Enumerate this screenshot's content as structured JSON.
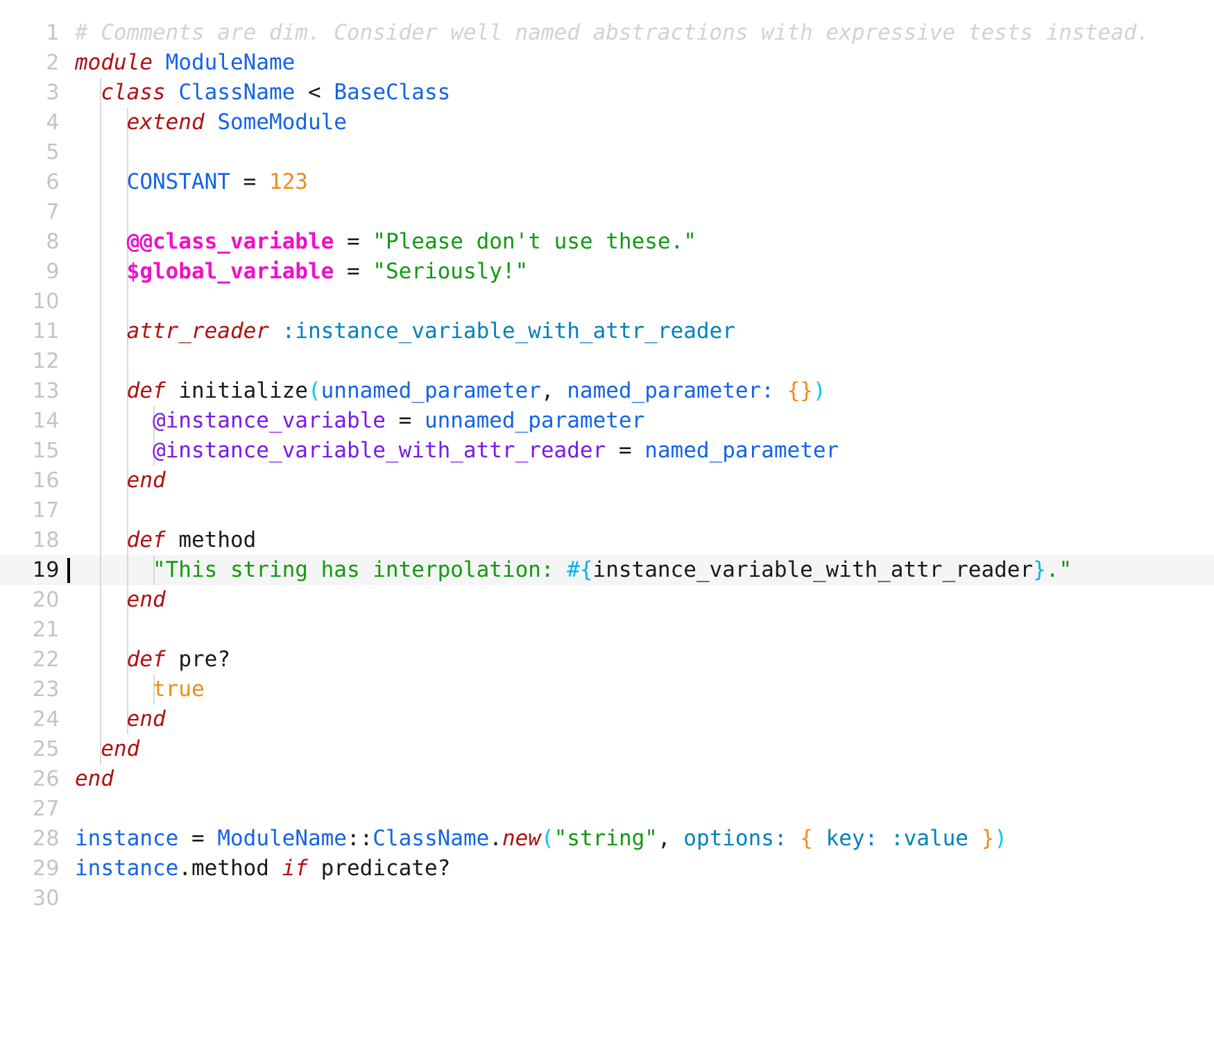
{
  "editor": {
    "language": "ruby",
    "active_line": 19,
    "total_lines": 30,
    "theme": {
      "background": "#ffffff",
      "active_line_background": "#f5f5f5",
      "gutter_text": "#c3c3c3",
      "gutter_active_text": "#1a1a1a",
      "cursor": "#000000",
      "indent_guide": "#d9d9d9",
      "comment": "#d2d2d2",
      "keyword": "#b01010",
      "constant": "#1464e6",
      "identifier": "#1464e6",
      "plain": "#1a1a1a",
      "number": "#f28c18",
      "boolean": "#f28c18",
      "string": "#119911",
      "class_variable": "#f010c8",
      "global_variable": "#f010c8",
      "instance_variable": "#7a1ae6",
      "symbol": "#0081bd",
      "bracket_level_1": "#00c8e6",
      "bracket_level_2": "#f28c18",
      "interpolation": "#00b4e6"
    }
  },
  "lines": [
    {
      "number": "1",
      "indent": 0,
      "guides": 0,
      "tokens": [
        {
          "c": "t-comment",
          "t": "# Comments are dim. Consider well named abstractions with expressive tests instead."
        }
      ]
    },
    {
      "number": "2",
      "indent": 0,
      "guides": 0,
      "tokens": [
        {
          "c": "t-kw",
          "t": "module"
        },
        {
          "c": "t-plain",
          "t": " "
        },
        {
          "c": "t-const",
          "t": "ModuleName"
        }
      ]
    },
    {
      "number": "3",
      "indent": 1,
      "guides": 1,
      "tokens": [
        {
          "c": "t-plain",
          "t": "  "
        },
        {
          "c": "t-kw",
          "t": "class"
        },
        {
          "c": "t-plain",
          "t": " "
        },
        {
          "c": "t-const",
          "t": "ClassName"
        },
        {
          "c": "t-plain",
          "t": " "
        },
        {
          "c": "t-op",
          "t": "<"
        },
        {
          "c": "t-plain",
          "t": " "
        },
        {
          "c": "t-const",
          "t": "BaseClass"
        }
      ]
    },
    {
      "number": "4",
      "indent": 2,
      "guides": 2,
      "tokens": [
        {
          "c": "t-plain",
          "t": "    "
        },
        {
          "c": "t-kw",
          "t": "extend"
        },
        {
          "c": "t-plain",
          "t": " "
        },
        {
          "c": "t-const",
          "t": "SomeModule"
        }
      ]
    },
    {
      "number": "5",
      "indent": 0,
      "guides": 2,
      "tokens": []
    },
    {
      "number": "6",
      "indent": 2,
      "guides": 2,
      "tokens": [
        {
          "c": "t-plain",
          "t": "    "
        },
        {
          "c": "t-const",
          "t": "CONSTANT"
        },
        {
          "c": "t-plain",
          "t": " "
        },
        {
          "c": "t-op",
          "t": "="
        },
        {
          "c": "t-plain",
          "t": " "
        },
        {
          "c": "t-num",
          "t": "123"
        }
      ]
    },
    {
      "number": "7",
      "indent": 0,
      "guides": 2,
      "tokens": []
    },
    {
      "number": "8",
      "indent": 2,
      "guides": 2,
      "tokens": [
        {
          "c": "t-plain",
          "t": "    "
        },
        {
          "c": "t-cvar",
          "t": "@@class_variable"
        },
        {
          "c": "t-plain",
          "t": " "
        },
        {
          "c": "t-op",
          "t": "="
        },
        {
          "c": "t-plain",
          "t": " "
        },
        {
          "c": "t-str",
          "t": "\"Please don't use these.\""
        }
      ]
    },
    {
      "number": "9",
      "indent": 2,
      "guides": 2,
      "tokens": [
        {
          "c": "t-plain",
          "t": "    "
        },
        {
          "c": "t-gvar",
          "t": "$global_variable"
        },
        {
          "c": "t-plain",
          "t": " "
        },
        {
          "c": "t-op",
          "t": "="
        },
        {
          "c": "t-plain",
          "t": " "
        },
        {
          "c": "t-str",
          "t": "\"Seriously!\""
        }
      ]
    },
    {
      "number": "10",
      "indent": 0,
      "guides": 2,
      "tokens": []
    },
    {
      "number": "11",
      "indent": 2,
      "guides": 2,
      "tokens": [
        {
          "c": "t-plain",
          "t": "    "
        },
        {
          "c": "t-kw",
          "t": "attr_reader"
        },
        {
          "c": "t-plain",
          "t": " "
        },
        {
          "c": "t-sym",
          "t": ":instance_variable_with_attr_reader"
        }
      ]
    },
    {
      "number": "12",
      "indent": 0,
      "guides": 2,
      "tokens": []
    },
    {
      "number": "13",
      "indent": 2,
      "guides": 2,
      "tokens": [
        {
          "c": "t-plain",
          "t": "    "
        },
        {
          "c": "t-kw",
          "t": "def"
        },
        {
          "c": "t-plain",
          "t": " "
        },
        {
          "c": "t-plain",
          "t": "initialize"
        },
        {
          "c": "t-br1",
          "t": "("
        },
        {
          "c": "t-ident",
          "t": "unnamed_parameter"
        },
        {
          "c": "t-op",
          "t": ","
        },
        {
          "c": "t-plain",
          "t": " "
        },
        {
          "c": "t-ident",
          "t": "named_parameter:"
        },
        {
          "c": "t-plain",
          "t": " "
        },
        {
          "c": "t-br2",
          "t": "{}"
        },
        {
          "c": "t-br1",
          "t": ")"
        }
      ]
    },
    {
      "number": "14",
      "indent": 3,
      "guides": 3,
      "tokens": [
        {
          "c": "t-plain",
          "t": "      "
        },
        {
          "c": "t-ivar",
          "t": "@instance_variable"
        },
        {
          "c": "t-plain",
          "t": " "
        },
        {
          "c": "t-op",
          "t": "="
        },
        {
          "c": "t-plain",
          "t": " "
        },
        {
          "c": "t-ident",
          "t": "unnamed_parameter"
        }
      ]
    },
    {
      "number": "15",
      "indent": 3,
      "guides": 3,
      "tokens": [
        {
          "c": "t-plain",
          "t": "      "
        },
        {
          "c": "t-ivar",
          "t": "@instance_variable_with_attr_reader"
        },
        {
          "c": "t-plain",
          "t": " "
        },
        {
          "c": "t-op",
          "t": "="
        },
        {
          "c": "t-plain",
          "t": " "
        },
        {
          "c": "t-ident",
          "t": "named_parameter"
        }
      ]
    },
    {
      "number": "16",
      "indent": 2,
      "guides": 2,
      "tokens": [
        {
          "c": "t-plain",
          "t": "    "
        },
        {
          "c": "t-kw",
          "t": "end"
        }
      ]
    },
    {
      "number": "17",
      "indent": 0,
      "guides": 2,
      "tokens": []
    },
    {
      "number": "18",
      "indent": 2,
      "guides": 2,
      "tokens": [
        {
          "c": "t-plain",
          "t": "    "
        },
        {
          "c": "t-kw",
          "t": "def"
        },
        {
          "c": "t-plain",
          "t": " "
        },
        {
          "c": "t-plain",
          "t": "method"
        }
      ]
    },
    {
      "number": "19",
      "indent": 3,
      "guides": 3,
      "active": true,
      "tokens": [
        {
          "c": "t-plain",
          "t": "      "
        },
        {
          "c": "t-str",
          "t": "\"This string has interpolation: "
        },
        {
          "c": "t-interp",
          "t": "#{"
        },
        {
          "c": "t-plain",
          "t": "instance_variable_with_attr_reader"
        },
        {
          "c": "t-interp",
          "t": "}"
        },
        {
          "c": "t-str",
          "t": ".\""
        }
      ]
    },
    {
      "number": "20",
      "indent": 2,
      "guides": 2,
      "tokens": [
        {
          "c": "t-plain",
          "t": "    "
        },
        {
          "c": "t-kw",
          "t": "end"
        }
      ]
    },
    {
      "number": "21",
      "indent": 0,
      "guides": 2,
      "tokens": []
    },
    {
      "number": "22",
      "indent": 2,
      "guides": 2,
      "tokens": [
        {
          "c": "t-plain",
          "t": "    "
        },
        {
          "c": "t-kw",
          "t": "def"
        },
        {
          "c": "t-plain",
          "t": " "
        },
        {
          "c": "t-plain",
          "t": "pre?"
        }
      ]
    },
    {
      "number": "23",
      "indent": 3,
      "guides": 3,
      "tokens": [
        {
          "c": "t-plain",
          "t": "      "
        },
        {
          "c": "t-bool",
          "t": "true"
        }
      ]
    },
    {
      "number": "24",
      "indent": 2,
      "guides": 2,
      "tokens": [
        {
          "c": "t-plain",
          "t": "    "
        },
        {
          "c": "t-kw",
          "t": "end"
        }
      ]
    },
    {
      "number": "25",
      "indent": 1,
      "guides": 1,
      "tokens": [
        {
          "c": "t-plain",
          "t": "  "
        },
        {
          "c": "t-kw",
          "t": "end"
        }
      ]
    },
    {
      "number": "26",
      "indent": 0,
      "guides": 0,
      "tokens": [
        {
          "c": "t-kw",
          "t": "end"
        }
      ]
    },
    {
      "number": "27",
      "indent": 0,
      "guides": 0,
      "tokens": []
    },
    {
      "number": "28",
      "indent": 0,
      "guides": 0,
      "tokens": [
        {
          "c": "t-ident",
          "t": "instance"
        },
        {
          "c": "t-plain",
          "t": " "
        },
        {
          "c": "t-op",
          "t": "="
        },
        {
          "c": "t-plain",
          "t": " "
        },
        {
          "c": "t-const",
          "t": "ModuleName"
        },
        {
          "c": "t-op",
          "t": "::"
        },
        {
          "c": "t-const",
          "t": "ClassName"
        },
        {
          "c": "t-op",
          "t": "."
        },
        {
          "c": "t-kw",
          "t": "new"
        },
        {
          "c": "t-br1",
          "t": "("
        },
        {
          "c": "t-str",
          "t": "\"string\""
        },
        {
          "c": "t-op",
          "t": ","
        },
        {
          "c": "t-plain",
          "t": " "
        },
        {
          "c": "t-sym",
          "t": "options:"
        },
        {
          "c": "t-plain",
          "t": " "
        },
        {
          "c": "t-br2",
          "t": "{"
        },
        {
          "c": "t-plain",
          "t": " "
        },
        {
          "c": "t-sym",
          "t": "key:"
        },
        {
          "c": "t-plain",
          "t": " "
        },
        {
          "c": "t-sym",
          "t": ":value"
        },
        {
          "c": "t-plain",
          "t": " "
        },
        {
          "c": "t-br2",
          "t": "}"
        },
        {
          "c": "t-br1",
          "t": ")"
        }
      ]
    },
    {
      "number": "29",
      "indent": 0,
      "guides": 0,
      "tokens": [
        {
          "c": "t-ident",
          "t": "instance"
        },
        {
          "c": "t-op",
          "t": "."
        },
        {
          "c": "t-plain",
          "t": "method"
        },
        {
          "c": "t-plain",
          "t": " "
        },
        {
          "c": "t-kw",
          "t": "if"
        },
        {
          "c": "t-plain",
          "t": " "
        },
        {
          "c": "t-plain",
          "t": "predicate?"
        }
      ]
    },
    {
      "number": "30",
      "indent": 0,
      "guides": 0,
      "tokens": []
    }
  ]
}
